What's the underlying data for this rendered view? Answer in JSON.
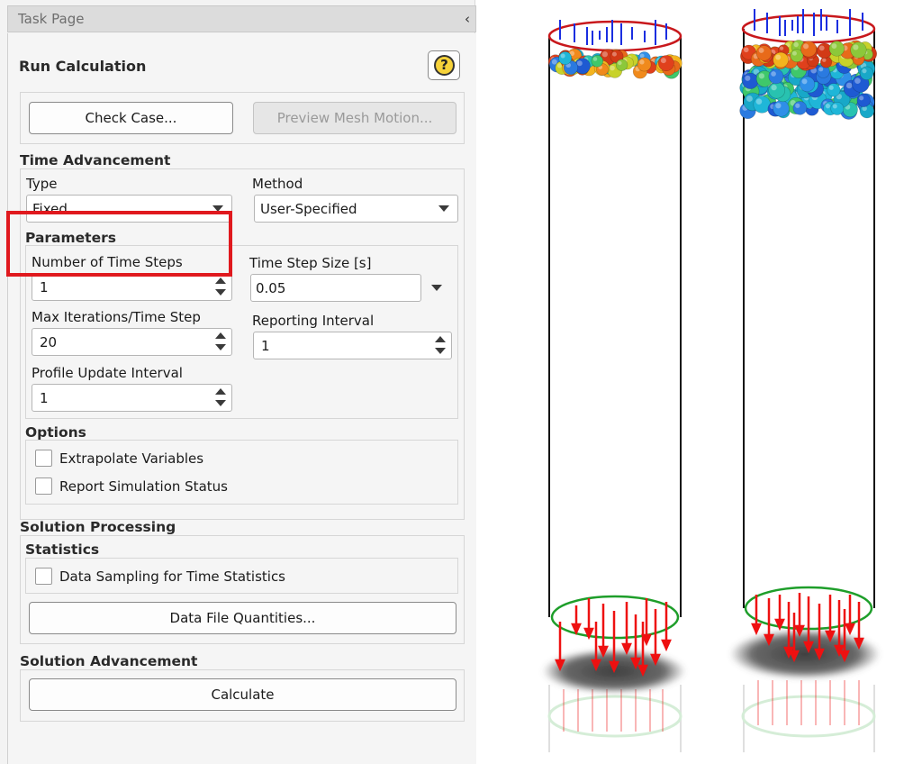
{
  "panel": {
    "title": "Task Page",
    "collapse_glyph": "‹",
    "header": "Run Calculation",
    "help_glyph": "?",
    "buttons": {
      "check_case": "Check Case...",
      "preview_mesh_motion": "Preview Mesh Motion..."
    },
    "time_advancement": {
      "title": "Time Advancement",
      "type_label": "Type",
      "type_value": "Fixed",
      "method_label": "Method",
      "method_value": "User-Specified"
    },
    "parameters": {
      "title": "Parameters",
      "num_time_steps_label": "Number of Time Steps",
      "num_time_steps_value": "1",
      "time_step_size_label": "Time Step Size [s]",
      "time_step_size_value": "0.05",
      "max_iterations_label": "Max Iterations/Time Step",
      "max_iterations_value": "20",
      "reporting_interval_label": "Reporting Interval",
      "reporting_interval_value": "1",
      "profile_update_label": "Profile Update Interval",
      "profile_update_value": "1"
    },
    "options": {
      "title": "Options",
      "extrapolate_variables": "Extrapolate Variables",
      "report_simulation_status": "Report Simulation Status"
    },
    "solution_processing": {
      "title": "Solution Processing",
      "statistics_title": "Statistics",
      "data_sampling": "Data Sampling for Time Statistics",
      "data_file_quantities": "Data File Quantities..."
    },
    "solution_advancement": {
      "title": "Solution Advancement",
      "calculate": "Calculate"
    }
  },
  "colors": {
    "highlight": "#e0191e",
    "inlet_ring": "#c8181c",
    "outlet_ring": "#1e9e2a",
    "inlet_arrows": "#1a2ee0",
    "outlet_arrows": "#ee1111"
  }
}
